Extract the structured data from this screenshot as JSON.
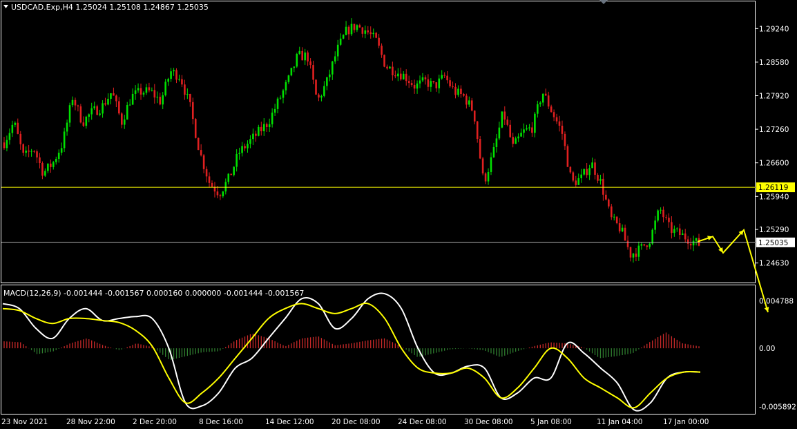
{
  "header": {
    "symbol_info": "USDCAD.Exp,H4  1.25024 1.25108 1.24867 1.25035",
    "macd_info": "MACD(12,26,9) -0.001444 -0.001567 0.000160 0.000000 -0.001444 -0.001567"
  },
  "colors": {
    "background": "#000000",
    "frame": "#ffffff",
    "bull_candle": "#00e000",
    "bear_candle": "#e02020",
    "macd_line": "#ffffff",
    "signal_line": "#ffff00",
    "hist_positive": "#cc2a2a",
    "hist_negative": "#2f7d2f",
    "price_marker_bg": "#ffffff",
    "level_marker_bg": "#ffff00",
    "arrow": "#ffff00"
  },
  "chart_data": {
    "type": "candlestick",
    "price_axis": {
      "min": 1.243,
      "max": 1.2972,
      "ticks": [
        "1.29240",
        "1.28580",
        "1.27920",
        "1.27260",
        "1.26600",
        "1.25940",
        "1.25290",
        "1.24630"
      ]
    },
    "macd_axis": {
      "min": -0.0064,
      "max": 0.006,
      "ticks": [
        "0.004788",
        "0.00",
        "-0.005892"
      ]
    },
    "time_labels": [
      "23 Nov 2021",
      "28 Nov 22:00",
      "2 Dec 20:00",
      "8 Dec 16:00",
      "14 Dec 12:00",
      "20 Dec 08:00",
      "24 Dec 08:00",
      "30 Dec 08:00",
      "5 Jan 08:00",
      "11 Jan 04:00",
      "17 Jan 00:00"
    ],
    "horizontal_levels": [
      {
        "price": 1.26119,
        "label": "1.26119",
        "style": "level"
      },
      {
        "price": 1.25035,
        "label": "1.25035",
        "style": "current"
      }
    ],
    "price_path": [
      1.27,
      1.274,
      1.267,
      1.269,
      1.264,
      1.266,
      1.27,
      1.279,
      1.274,
      1.276,
      1.277,
      1.28,
      1.274,
      1.279,
      1.28,
      1.28,
      1.278,
      1.284,
      1.283,
      1.277,
      1.268,
      1.262,
      1.26,
      1.263,
      1.268,
      1.27,
      1.272,
      1.274,
      1.278,
      1.282,
      1.287,
      1.287,
      1.278,
      1.282,
      1.288,
      1.292,
      1.293,
      1.292,
      1.29,
      1.285,
      1.284,
      1.283,
      1.281,
      1.282,
      1.281,
      1.283,
      1.28,
      1.279,
      1.276,
      1.262,
      1.268,
      1.276,
      1.269,
      1.272,
      1.273,
      1.28,
      1.276,
      1.272,
      1.262,
      1.263,
      1.266,
      1.262,
      1.255,
      1.253,
      1.248,
      1.249,
      1.251,
      1.257,
      1.253,
      1.252,
      1.251,
      1.25
    ],
    "macd_main": [
      0.0045,
      0.004,
      0.002,
      0.001,
      0.003,
      0.004,
      0.0028,
      0.003,
      0.0032,
      0.003,
      0.0,
      -0.0055,
      -0.0058,
      -0.0045,
      -0.002,
      -0.001,
      0.001,
      0.003,
      0.005,
      0.0045,
      0.002,
      0.003,
      0.005,
      0.0055,
      0.004,
      0.0,
      -0.0025,
      -0.0025,
      -0.0018,
      -0.002,
      -0.005,
      -0.0045,
      -0.003,
      -0.003,
      0.0005,
      -0.0005,
      -0.002,
      -0.0035,
      -0.0062,
      -0.0055,
      -0.003,
      -0.0024,
      -0.0024
    ],
    "macd_signal": [
      0.004,
      0.0038,
      0.003,
      0.0025,
      0.003,
      0.003,
      0.0028,
      0.0026,
      0.0018,
      0.0002,
      -0.003,
      -0.0055,
      -0.0045,
      -0.003,
      -0.001,
      0.001,
      0.003,
      0.004,
      0.0045,
      0.004,
      0.0035,
      0.004,
      0.0045,
      0.003,
      0.0,
      -0.002,
      -0.0025,
      -0.0025,
      -0.002,
      -0.003,
      -0.005,
      -0.004,
      -0.002,
      0.0,
      -0.001,
      -0.003,
      -0.004,
      -0.005,
      -0.006,
      -0.0045,
      -0.003,
      -0.0024,
      -0.0024
    ],
    "macd_histogram": [
      0.0007,
      0.0006,
      -0.0006,
      -0.0003,
      0.0005,
      0.001,
      0.0003,
      -0.0002,
      0.0005,
      0.0001,
      -0.0012,
      -0.0008,
      -0.0004,
      -0.0003,
      0.0008,
      0.0015,
      0.001,
      0.0002,
      0.001,
      0.0012,
      0.0003,
      0.0005,
      0.0008,
      0.001,
      0.0002,
      -0.0009,
      -0.0005,
      -0.0001,
      0.0,
      -0.0002,
      -0.0009,
      -0.0003,
      0.0002,
      0.0006,
      0.0005,
      0.0001,
      -0.001,
      -0.0008,
      -0.0005,
      0.0006,
      0.0016,
      0.0005,
      0.0002
    ],
    "projection_arrow": [
      1.2505,
      1.2515,
      1.2483,
      1.2528,
      1.243
    ]
  }
}
